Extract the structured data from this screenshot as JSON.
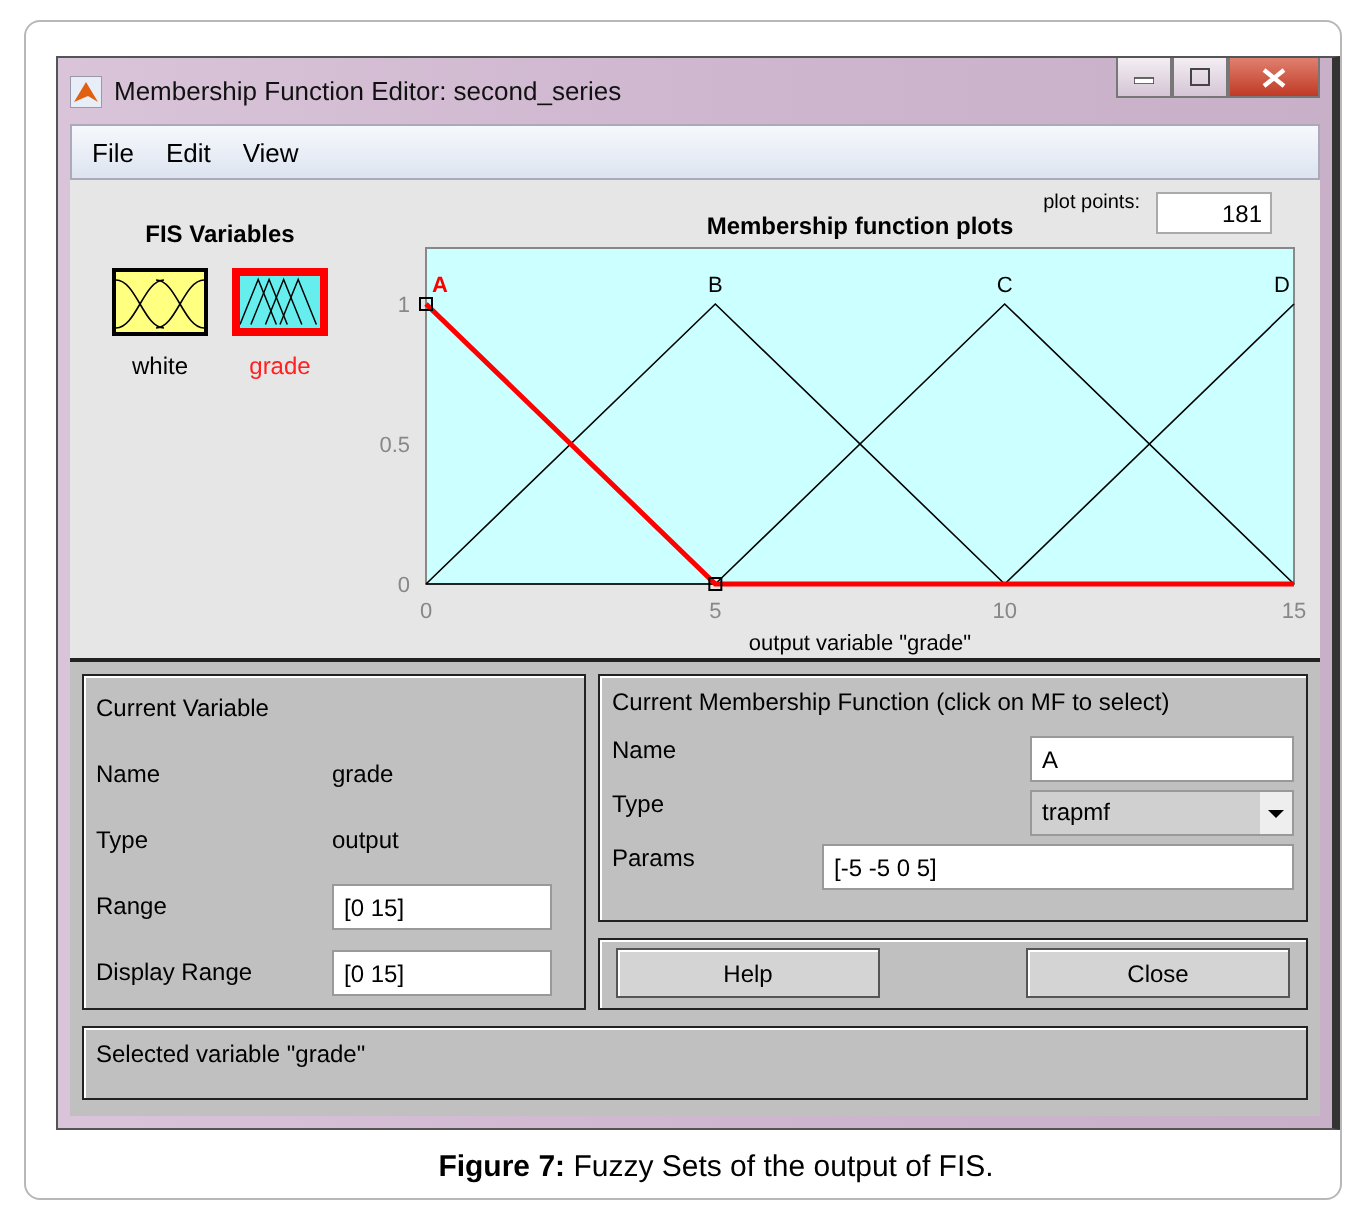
{
  "window": {
    "title": "Membership Function Editor: second_series"
  },
  "menu": [
    "File",
    "Edit",
    "View"
  ],
  "fis_variables": {
    "title": "FIS Variables",
    "items": [
      {
        "label": "white",
        "kind": "input",
        "selected": false
      },
      {
        "label": "grade",
        "kind": "output",
        "selected": true
      }
    ]
  },
  "plot": {
    "plot_points_label": "plot points:",
    "plot_points": "181",
    "chart_data": {
      "type": "line",
      "title": "Membership function plots",
      "xlabel": "output variable \"grade\"",
      "x": [
        0,
        5,
        10,
        15
      ],
      "xlim": [
        0,
        15
      ],
      "ylim": [
        0,
        1.2
      ],
      "xticks": [
        0,
        5,
        10,
        15
      ],
      "yticks": [
        0,
        0.5,
        1
      ],
      "series": [
        {
          "name": "A",
          "color": "#ff0000",
          "values": [
            1,
            0,
            0,
            0
          ]
        },
        {
          "name": "B",
          "color": "#000000",
          "values": [
            0,
            1,
            0,
            null
          ]
        },
        {
          "name": "C",
          "color": "#000000",
          "values": [
            null,
            0,
            1,
            0
          ]
        },
        {
          "name": "D",
          "color": "#000000",
          "values": [
            null,
            null,
            0,
            1
          ]
        }
      ]
    }
  },
  "current_variable": {
    "title": "Current Variable",
    "rows": [
      {
        "label": "Name",
        "value": "grade",
        "kind": "text"
      },
      {
        "label": "Type",
        "value": "output",
        "kind": "text"
      },
      {
        "label": "Range",
        "value": "[0 15]",
        "kind": "field"
      },
      {
        "label": "Display Range",
        "value": "[0 15]",
        "kind": "field"
      }
    ]
  },
  "current_mf": {
    "title": "Current Membership Function (click on MF to select)",
    "rows": [
      {
        "label": "Name",
        "value": "A",
        "kind": "field"
      },
      {
        "label": "Type",
        "value": "trapmf",
        "kind": "select"
      },
      {
        "label": "Params",
        "value": "[-5 -5 0 5]",
        "kind": "wide"
      }
    ]
  },
  "buttons": [
    "Help",
    "Close"
  ],
  "status": "Selected variable \"grade\"",
  "caption": {
    "label": "Figure 7:",
    "text": "Fuzzy Sets of the output of FIS."
  }
}
